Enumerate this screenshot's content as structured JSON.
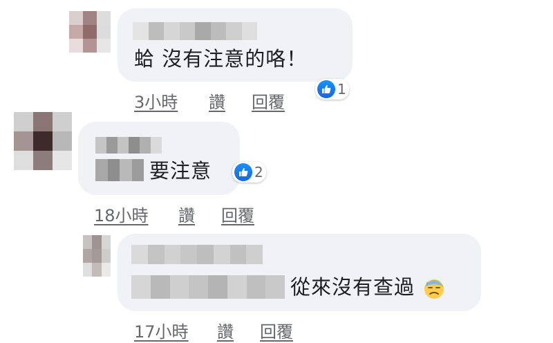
{
  "comments": [
    {
      "text": "蛤 沒有注意的咯！",
      "time": "3小時",
      "like_label": "讚",
      "reply_label": "回覆",
      "reaction_count": "1",
      "reaction_icon": "thumbs-up-icon",
      "avatar_colors": [
        "#d9cfcf",
        "#a08484",
        "#dddddd",
        "#c7a8a8",
        "#8f6b6b",
        "#dcdcdc",
        "#e8dcdc",
        "#b39494",
        "#e6e6e6"
      ],
      "name_blur_colors": [
        "#e4e4e4",
        "#bdbdbd",
        "#d6d6d6",
        "#c9c9c9",
        "#a9a9a9",
        "#bcbcbc",
        "#cfcfcf",
        "#dedede"
      ]
    },
    {
      "text": "要注意",
      "time": "18小時",
      "like_label": "讚",
      "reply_label": "回覆",
      "reaction_count": "2",
      "reaction_icon": "thumbs-up-icon",
      "avatar_colors": [
        "#cfcfcf",
        "#8a7474",
        "#cfcfcf",
        "#a59494",
        "#3e2a2a",
        "#b8b8b8",
        "#dedede",
        "#8d7c7c",
        "#e6e6e6"
      ],
      "name_blur_colors": [
        "#c5c5c5",
        "#9a9a9a",
        "#c4c4c4",
        "#8d8d8d",
        "#b0b0b0",
        "#dadada"
      ],
      "prefix_blur_colors": [
        "#a8a8a8",
        "#8e8e8e",
        "#b9b9b9",
        "#9c9c9c"
      ]
    },
    {
      "text": "從來沒有查過",
      "time": "17小時",
      "like_label": "讚",
      "reply_label": "回覆",
      "emoji": "downcast-sweat-face-icon",
      "avatar_colors": [
        "#c9c1c1",
        "#9e9292",
        "#d6d6d6",
        "#b1a6a6",
        "#a59a9a",
        "#cccccc",
        "#dedede",
        "#c3baba",
        "#e9e9e9"
      ],
      "name_blur_colors": [
        "#dadada",
        "#c3c3c3",
        "#d1d1d1",
        "#c7c7c7",
        "#bebebe",
        "#d3d3d3",
        "#c1c1c1",
        "#cfcfcf"
      ],
      "prefix_blur_colors": [
        "#d5d5d5",
        "#b9b9b9",
        "#cfcfcf",
        "#c4c4c4",
        "#b4b4b4",
        "#d2d2d2",
        "#bfbfbf",
        "#c9c9c9"
      ]
    }
  ],
  "colors": {
    "bubble": "#f0f2f5",
    "like_blue": "#1877f2",
    "meta_text": "#65676b"
  }
}
